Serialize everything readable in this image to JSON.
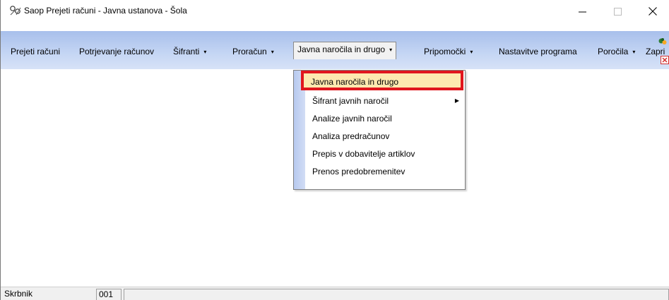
{
  "window": {
    "title": "Saop Prejeti računi - Javna ustanova - Šola",
    "controls": {
      "minimize": "—",
      "maximize": "☐",
      "close": "✕"
    }
  },
  "menubar": {
    "items": [
      {
        "label": "Prejeti računi",
        "has_dropdown": false
      },
      {
        "label": "Potrjevanje računov",
        "has_dropdown": false
      },
      {
        "label": "Šifranti",
        "has_dropdown": true
      },
      {
        "label": "Proračun",
        "has_dropdown": true
      },
      {
        "label": "Javna naročila in drugo",
        "has_dropdown": true,
        "open": true
      },
      {
        "label": "Pripomočki",
        "has_dropdown": true
      },
      {
        "label": "Nastavitve programa",
        "has_dropdown": false
      },
      {
        "label": "Poročila",
        "has_dropdown": true
      },
      {
        "label": "Zapri",
        "has_dropdown": false
      }
    ],
    "arrow": "▾"
  },
  "dropdown": {
    "items": [
      {
        "label": "Javna naročila in drugo",
        "selected": true
      },
      {
        "label": "Šifrant javnih naročil",
        "has_submenu": true
      },
      {
        "label": "Analize javnih naročil"
      },
      {
        "label": "Analiza predračunov"
      },
      {
        "label": "Prepis v dobavitelje artiklov"
      },
      {
        "label": "Prenos predobremenitev"
      }
    ],
    "submenu_arrow": "▶"
  },
  "statusbar": {
    "user": "Skrbnik",
    "code": "001",
    "message": ""
  },
  "colors": {
    "menubar_top": "#a8bfeb",
    "menubar_bottom": "#d7e2f7",
    "highlight_fill": "#fde9b0",
    "highlight_border": "#e0161e"
  }
}
